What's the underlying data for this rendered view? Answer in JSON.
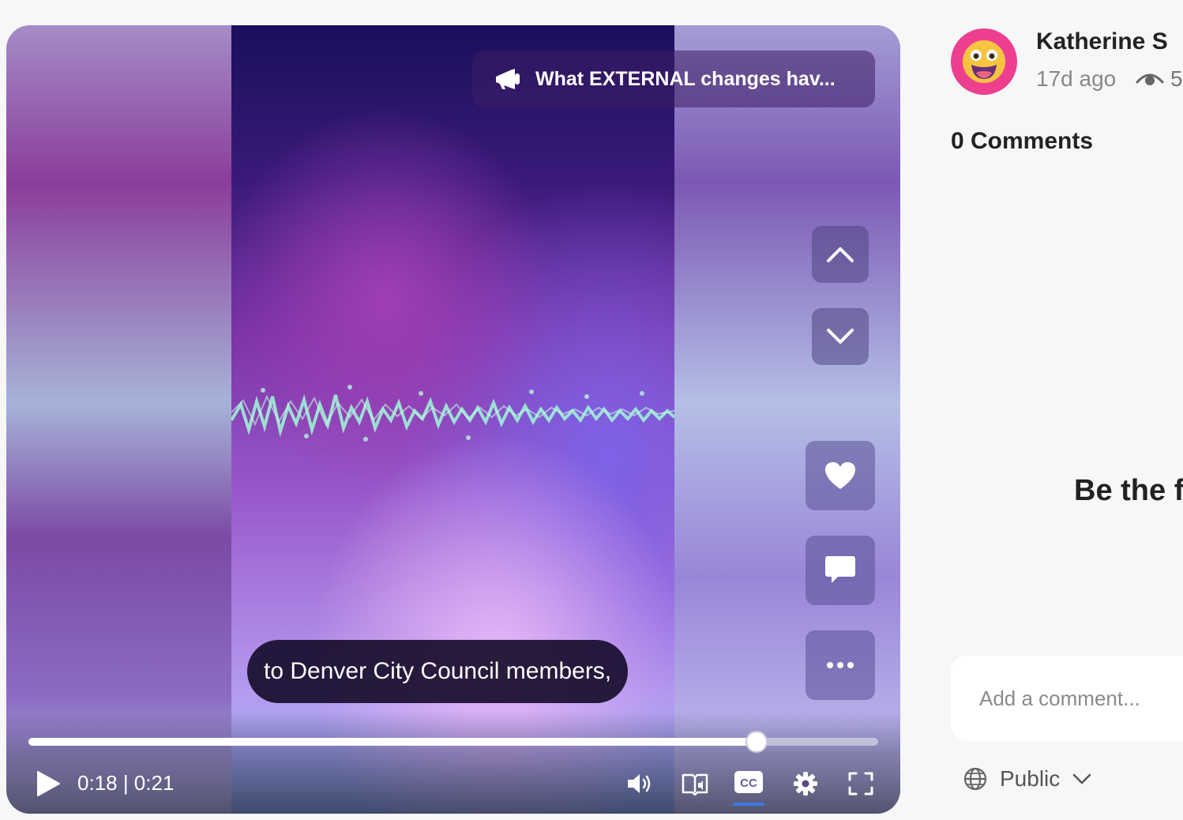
{
  "video": {
    "topic_title": "What EXTERNAL changes hav...",
    "caption": "to Denver City Council members,",
    "current_time": "0:18",
    "duration": "0:21",
    "time_display": "0:18 | 0:21",
    "progress_fraction": 0.857,
    "accent_color": "#3b7be0"
  },
  "post": {
    "author": "Katherine S",
    "posted_ago": "17d ago",
    "views": "5",
    "comments_heading": "0 Comments",
    "empty_state": "Be the f"
  },
  "comment_input": {
    "placeholder": "Add a comment..."
  },
  "privacy": {
    "selected": "Public"
  },
  "icons": {
    "topic": "megaphone-icon",
    "up": "chevron-up-icon",
    "down": "chevron-down-icon",
    "like": "heart-icon",
    "comment": "comment-bubble-icon",
    "more": "more-dots-icon",
    "play": "play-icon",
    "volume": "volume-icon",
    "audio_description": "audio-description-icon",
    "captions": "closed-captions-icon",
    "settings": "gear-icon",
    "fullscreen": "fullscreen-icon",
    "views": "eye-icon",
    "privacy": "globe-icon"
  }
}
